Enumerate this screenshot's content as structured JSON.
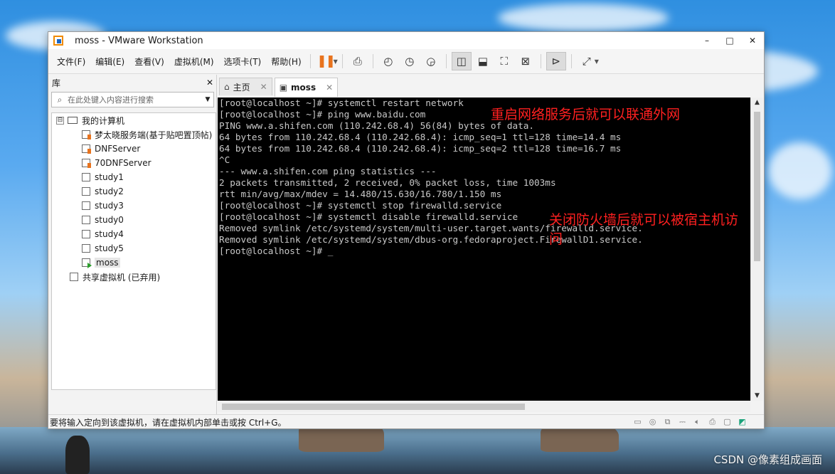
{
  "window": {
    "title": "moss - VMware Workstation"
  },
  "window_controls": {
    "minimize": "–",
    "maximize": "□",
    "close": "✕"
  },
  "menu": [
    {
      "label": "文件(F)"
    },
    {
      "label": "编辑(E)"
    },
    {
      "label": "查看(V)"
    },
    {
      "label": "虚拟机(M)"
    },
    {
      "label": "选项卡(T)"
    },
    {
      "label": "帮助(H)"
    }
  ],
  "toolbar": {
    "icons": [
      "pause-icon",
      "send-ctrl-alt-del-icon",
      "snapshot-icon",
      "revert-snapshot-icon",
      "snapshot-manager-icon",
      "library-view-icon",
      "thumbnail-view-icon",
      "fullscreen-icon",
      "unity-icon",
      "console-view-icon",
      "stretch-icon"
    ]
  },
  "library": {
    "title": "库",
    "close": "✕",
    "search_placeholder": "在此处键入内容进行搜索",
    "root": {
      "label": "我的计算机",
      "expander": "⊟"
    },
    "vms": [
      {
        "label": "梦太晓服务端(基于贴吧置顶帖)",
        "state": "running"
      },
      {
        "label": "DNFServer",
        "state": "running"
      },
      {
        "label": "70DNFServer",
        "state": "running"
      },
      {
        "label": "study1",
        "state": "off"
      },
      {
        "label": "study2",
        "state": "off"
      },
      {
        "label": "study3",
        "state": "off"
      },
      {
        "label": "study0",
        "state": "off"
      },
      {
        "label": "study4",
        "state": "off"
      },
      {
        "label": "study5",
        "state": "off"
      },
      {
        "label": "moss",
        "state": "active"
      }
    ],
    "shared": {
      "label": "共享虚拟机 (已弃用)"
    }
  },
  "tabs": [
    {
      "label": "主页",
      "icon": "home-icon",
      "close": "✕"
    },
    {
      "label": "moss",
      "icon": "vm-tab-icon",
      "close": "✕"
    }
  ],
  "console": {
    "lines": [
      "[root@localhost ~]# systemctl restart network",
      "[root@localhost ~]# ping www.baidu.com",
      "PING www.a.shifen.com (110.242.68.4) 56(84) bytes of data.",
      "64 bytes from 110.242.68.4 (110.242.68.4): icmp_seq=1 ttl=128 time=14.4 ms",
      "64 bytes from 110.242.68.4 (110.242.68.4): icmp_seq=2 ttl=128 time=16.7 ms",
      "^C",
      "--- www.a.shifen.com ping statistics ---",
      "2 packets transmitted, 2 received, 0% packet loss, time 1003ms",
      "rtt min/avg/max/mdev = 14.480/15.630/16.780/1.150 ms",
      "[root@localhost ~]# systemctl stop firewalld.service",
      "[root@localhost ~]# systemctl disable firewalld.service",
      "Removed symlink /etc/systemd/system/multi-user.target.wants/firewalld.service.",
      "Removed symlink /etc/systemd/system/dbus-org.fedoraproject.FirewallD1.service.",
      "[root@localhost ~]# "
    ],
    "annotations": [
      {
        "text": "重启网络服务后就可以联通外网"
      },
      {
        "text": "关闭防火墙后就可以被宿主机访问"
      }
    ],
    "text_color": "#c8c8c8",
    "annotation_color": "#ff2020"
  },
  "statusbar": {
    "message": "要将输入定向到该虚拟机，请在虚拟机内部单击或按 Ctrl+G。"
  },
  "desktop": {
    "watermark": "CSDN @像素组成画面"
  }
}
